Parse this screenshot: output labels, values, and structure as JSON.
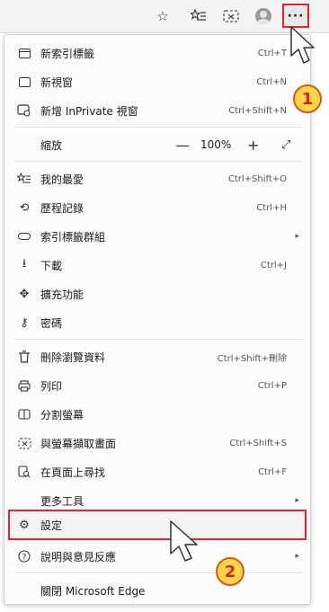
{
  "toolbar": {
    "icons": [
      "star-outline-icon",
      "favorites-icon",
      "screenshot-icon",
      "profile-avatar-icon"
    ],
    "more_label": "···"
  },
  "menu": {
    "items": [
      {
        "label": "新索引標籤",
        "shortcut": "Ctrl+T",
        "icon": "new-tab-icon"
      },
      {
        "label": "新視窗",
        "shortcut": "Ctrl+N",
        "icon": "new-window-icon"
      },
      {
        "label": "新增 InPrivate 視窗",
        "shortcut": "Ctrl+Shift+N",
        "icon": "inprivate-icon"
      },
      {
        "label": "縮放",
        "zoom_value": "100%",
        "icon": "none"
      },
      {
        "label": "我的最愛",
        "shortcut": "Ctrl+Shift+O",
        "icon": "favorites-icon"
      },
      {
        "label": "歷程記錄",
        "shortcut": "Ctrl+H",
        "icon": "history-icon"
      },
      {
        "label": "索引標籤群組",
        "shortcut": "",
        "icon": "tab-groups-icon",
        "submenu": true
      },
      {
        "label": "下載",
        "shortcut": "Ctrl+J",
        "icon": "download-icon"
      },
      {
        "label": "擴充功能",
        "shortcut": "",
        "icon": "extensions-icon"
      },
      {
        "label": "密碼",
        "shortcut": "",
        "icon": "key-icon"
      },
      {
        "label": "刪除瀏覽資料",
        "shortcut": "Ctrl+Shift+刪除",
        "icon": "trash-icon"
      },
      {
        "label": "列印",
        "shortcut": "Ctrl+P",
        "icon": "print-icon"
      },
      {
        "label": "分割螢幕",
        "shortcut": "",
        "icon": "split-screen-icon"
      },
      {
        "label": "與螢幕擷取畫面",
        "shortcut": "Ctrl+Shift+S",
        "icon": "screenshot-icon"
      },
      {
        "label": "在頁面上尋找",
        "shortcut": "Ctrl+F",
        "icon": "find-icon"
      },
      {
        "label": "更多工具",
        "shortcut": "",
        "icon": "none",
        "submenu": true
      },
      {
        "label": "設定",
        "shortcut": "",
        "icon": "gear-icon"
      },
      {
        "label": "說明與意見反應",
        "shortcut": "",
        "icon": "help-icon",
        "submenu": true
      },
      {
        "label": "關閉 Microsoft Edge",
        "shortcut": "",
        "icon": "none"
      }
    ]
  },
  "badges": {
    "one": "1",
    "two": "2"
  },
  "colors": {
    "highlight": "#e3222b",
    "badge_fill": "#ffd44d",
    "badge_text": "#d9241b"
  }
}
